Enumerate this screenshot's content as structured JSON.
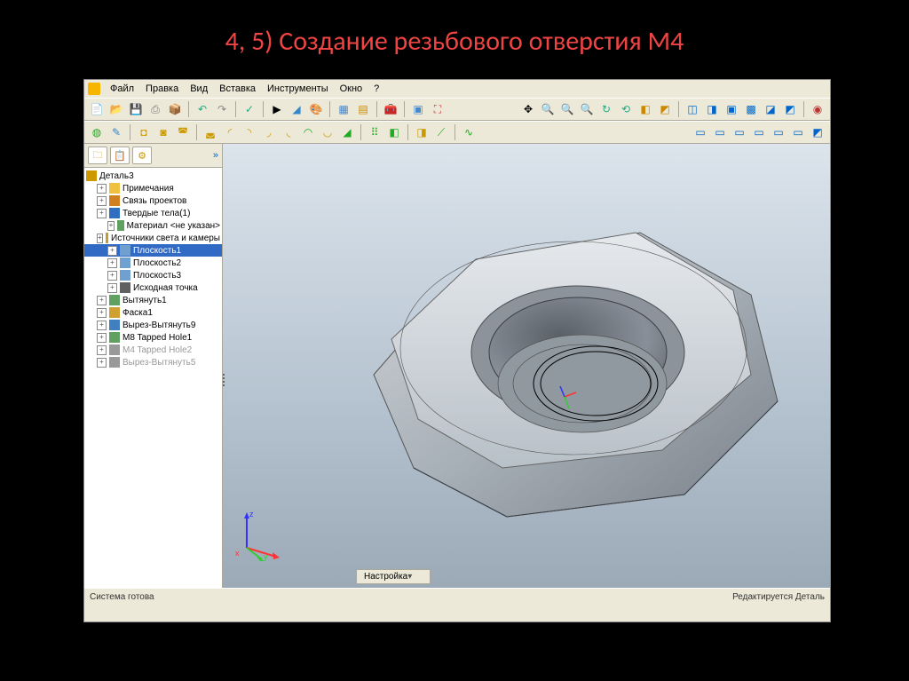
{
  "slide": {
    "title": "4, 5) Создание резьбового отверстия М4"
  },
  "menu": {
    "file": "Файл",
    "edit": "Правка",
    "view": "Вид",
    "insert": "Вставка",
    "tools": "Инструменты",
    "window": "Окно",
    "help": "?"
  },
  "tree": {
    "root": "Деталь3",
    "items": [
      {
        "label": "Примечания",
        "icon": "#f0c040"
      },
      {
        "label": "Связь проектов",
        "icon": "#d08020"
      },
      {
        "label": "Твердые тела(1)",
        "icon": "#3070c0"
      },
      {
        "label": "Материал <не указан>",
        "icon": "#60a060",
        "ind": 2
      },
      {
        "label": "Источники света и камеры",
        "icon": "#c0a030"
      },
      {
        "label": "Плоскость1",
        "icon": "#70a0d0",
        "ind": 2,
        "sel": true
      },
      {
        "label": "Плоскость2",
        "icon": "#70a0d0",
        "ind": 2
      },
      {
        "label": "Плоскость3",
        "icon": "#70a0d0",
        "ind": 2
      },
      {
        "label": "Исходная точка",
        "icon": "#606060",
        "ind": 2
      },
      {
        "label": "Вытянуть1",
        "icon": "#60a060"
      },
      {
        "label": "Фаска1",
        "icon": "#d0a030"
      },
      {
        "label": "Вырез-Вытянуть9",
        "icon": "#4080c0"
      },
      {
        "label": "M8 Tapped Hole1",
        "icon": "#60a060"
      },
      {
        "label": "M4 Tapped Hole2",
        "icon": "#999",
        "ind": 1,
        "disabled": true
      },
      {
        "label": "Вырез-Вытянуть5",
        "icon": "#999",
        "ind": 1,
        "disabled": true
      }
    ]
  },
  "viewport": {
    "bottom_button": "Настройка"
  },
  "status": {
    "left": "Система готова",
    "right": "Редактируется Деталь"
  }
}
